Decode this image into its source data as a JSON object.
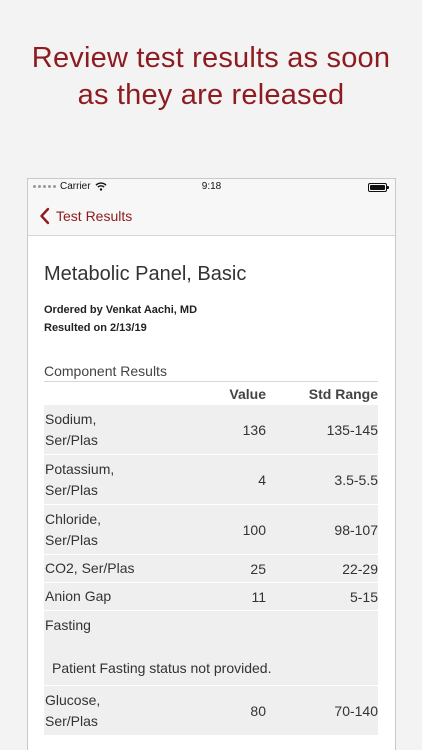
{
  "headline": {
    "line1": "Review test results as soon",
    "line2": "as they are released"
  },
  "statusbar": {
    "carrier": "Carrier",
    "time": "9:18"
  },
  "navbar": {
    "back_label": "Test Results"
  },
  "report": {
    "title": "Metabolic Panel, Basic",
    "ordered_by": "Ordered by Venkat Aachi, MD",
    "resulted_on": "Resulted on 2/13/19",
    "section_title": "Component Results",
    "headers": {
      "value": "Value",
      "range": "Std Range"
    },
    "rows": [
      {
        "line1": "Sodium,",
        "line2": "Ser/Plas",
        "value": "136",
        "range": "135-145"
      },
      {
        "line1": "Potassium,",
        "line2": "Ser/Plas",
        "value": "4",
        "range": "3.5-5.5"
      },
      {
        "line1": "Chloride,",
        "line2": "Ser/Plas",
        "value": "100",
        "range": "98-107"
      },
      {
        "name": "CO2, Ser/Plas",
        "value": "25",
        "range": "22-29"
      },
      {
        "name": "Anion Gap",
        "value": "11",
        "range": "5-15"
      }
    ],
    "fasting": {
      "label": "Fasting",
      "note": "Patient Fasting status not provided."
    },
    "glucose": {
      "line1": "Glucose,",
      "line2": "Ser/Plas",
      "value": "80",
      "range": "70-140"
    }
  },
  "colors": {
    "accent": "#8e1b1f",
    "row_bg": "#efefef"
  },
  "icons": {
    "back": "chevron-left-icon",
    "wifi": "wifi-icon",
    "battery": "battery-icon",
    "signal": "signal-dots-icon"
  }
}
